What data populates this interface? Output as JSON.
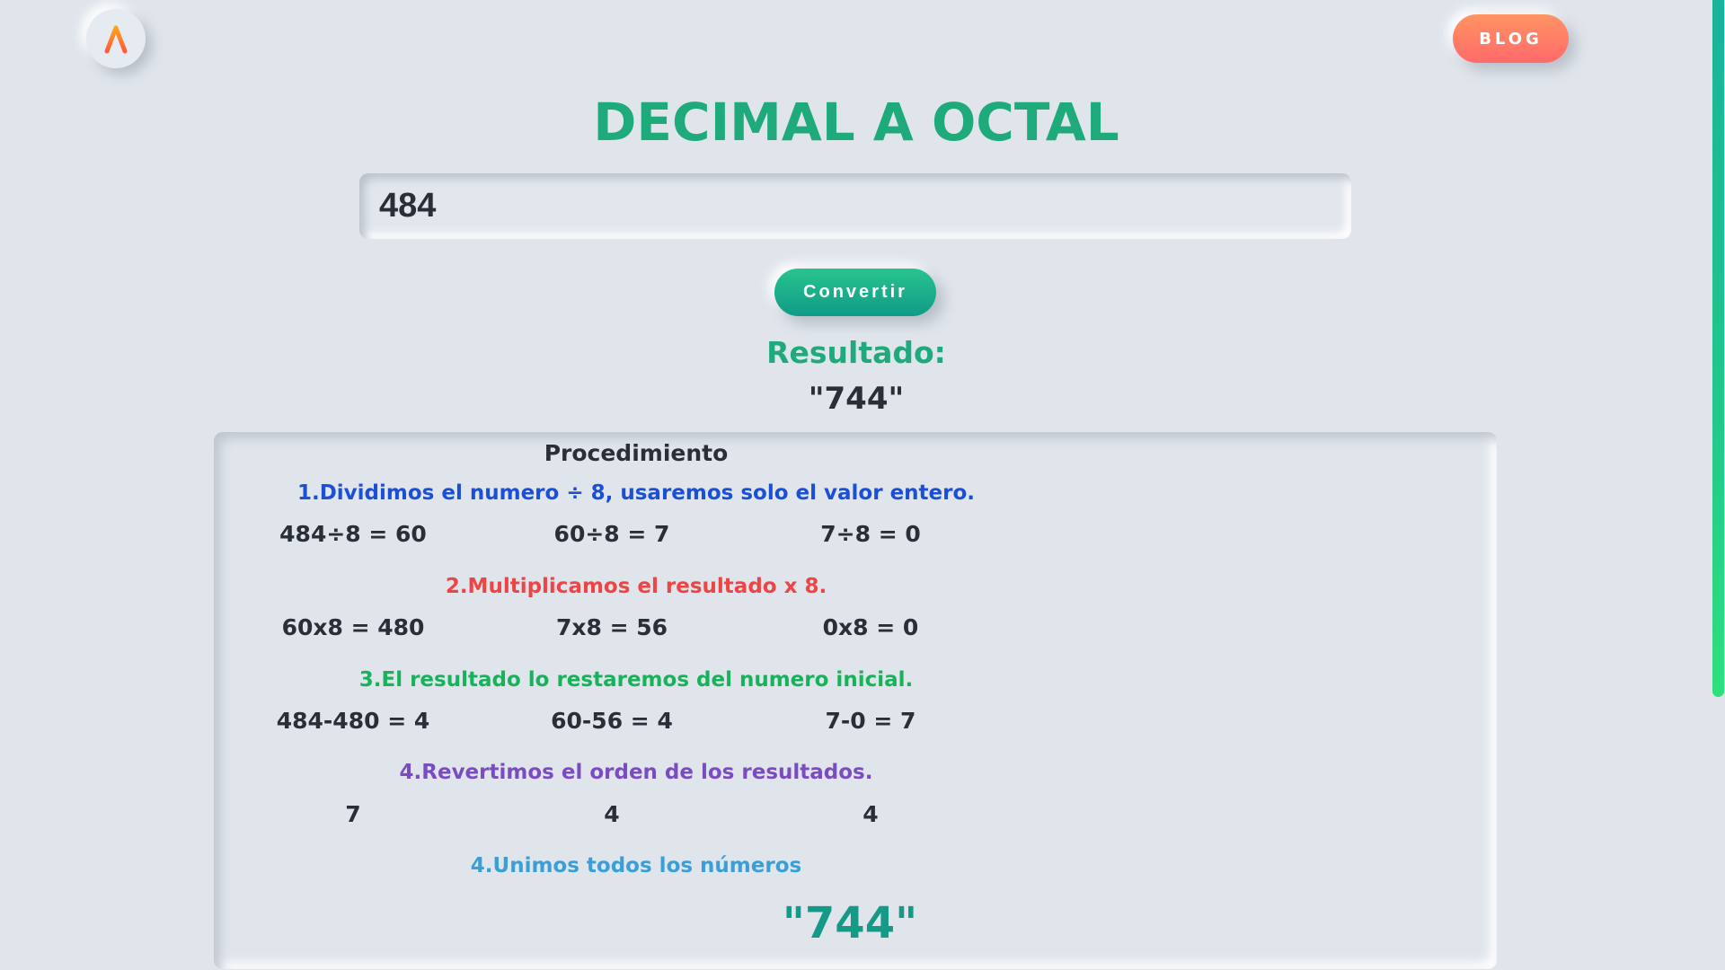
{
  "header": {
    "blog_label": "BLOG"
  },
  "page_title": "DECIMAL A OCTAL",
  "input": {
    "value": "484"
  },
  "convert_label": "Convertir",
  "result": {
    "label": "Resultado:",
    "value": "\"744\""
  },
  "procedure": {
    "title": "Procedimiento",
    "steps": [
      {
        "title": "1.Dividimos el numero ÷ 8, usaremos solo el valor entero.",
        "cells": [
          "484÷8 = 60",
          "60÷8 = 7",
          "7÷8 = 0"
        ]
      },
      {
        "title": "2.Multiplicamos el resultado x 8.",
        "cells": [
          "60x8 = 480",
          "7x8 = 56",
          "0x8 = 0"
        ]
      },
      {
        "title": "3.El resultado lo restaremos del numero inicial.",
        "cells": [
          "484-480 = 4",
          "60-56 = 4",
          "7-0 = 7"
        ]
      },
      {
        "title": "4.Revertimos el orden de los resultados.",
        "cells": [
          "7",
          "4",
          "4"
        ]
      },
      {
        "title": "4.Unimos todos los números"
      }
    ],
    "final_value": "\"744\""
  },
  "icons": {
    "logo": "lambda-logo-icon"
  },
  "colors": {
    "background": "#e0e5ec",
    "accent_green": "#1eaa7b",
    "blog_gradient": [
      "#ff9463",
      "#ff6a6a"
    ],
    "step_colors": [
      "#1b4fd6",
      "#ef4444",
      "#17b35a",
      "#7b4bc0",
      "#3a9fd6"
    ]
  }
}
